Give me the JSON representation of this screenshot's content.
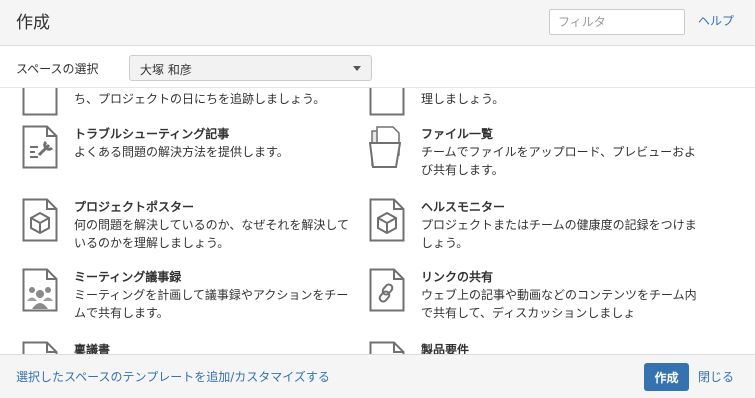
{
  "dialog": {
    "title": "作成"
  },
  "filter": {
    "placeholder": "フィルタ"
  },
  "help": {
    "label": "ヘルプ"
  },
  "space": {
    "label": "スペースの選択",
    "selected": "大塚 和彦"
  },
  "partial_top": {
    "left_desc": "ち、プロジェクトの日にちを追跡しましょう。",
    "right_desc": "理しましょう。"
  },
  "templates": [
    {
      "title": "トラブルシューティング記事",
      "desc": "よくある問題の解決方法を提供します。",
      "icon": "troubleshooting-icon"
    },
    {
      "title": "ファイル一覧",
      "desc": "チームでファイルをアップロード、プレビューおよび共有します。",
      "icon": "folder-icon"
    },
    {
      "title": "プロジェクトポスター",
      "desc": "何の問題を解決しているのか、なぜそれを解決しているのかを理解しましょう。",
      "icon": "cube-icon"
    },
    {
      "title": "ヘルスモニター",
      "desc": "プロジェクトまたはチームの健康度の記録をつけましょう。",
      "icon": "cube-icon"
    },
    {
      "title": "ミーティング議事録",
      "desc": "ミーティングを計画して議事録やアクションをチームで共有します。",
      "icon": "people-icon"
    },
    {
      "title": "リンクの共有",
      "desc": "ウェブ上の記事や動画などのコンテンツをチーム内で共有して、ディスカッションしましょ",
      "icon": "link-icon"
    },
    {
      "title": "稟議書",
      "desc": "",
      "icon": "document-icon"
    },
    {
      "title": "製品要件",
      "desc": "",
      "icon": "document-icon"
    }
  ],
  "footer": {
    "link": "選択したスペースのテンプレートを追加/カスタマイズする",
    "create": "作成",
    "close": "閉じる"
  }
}
